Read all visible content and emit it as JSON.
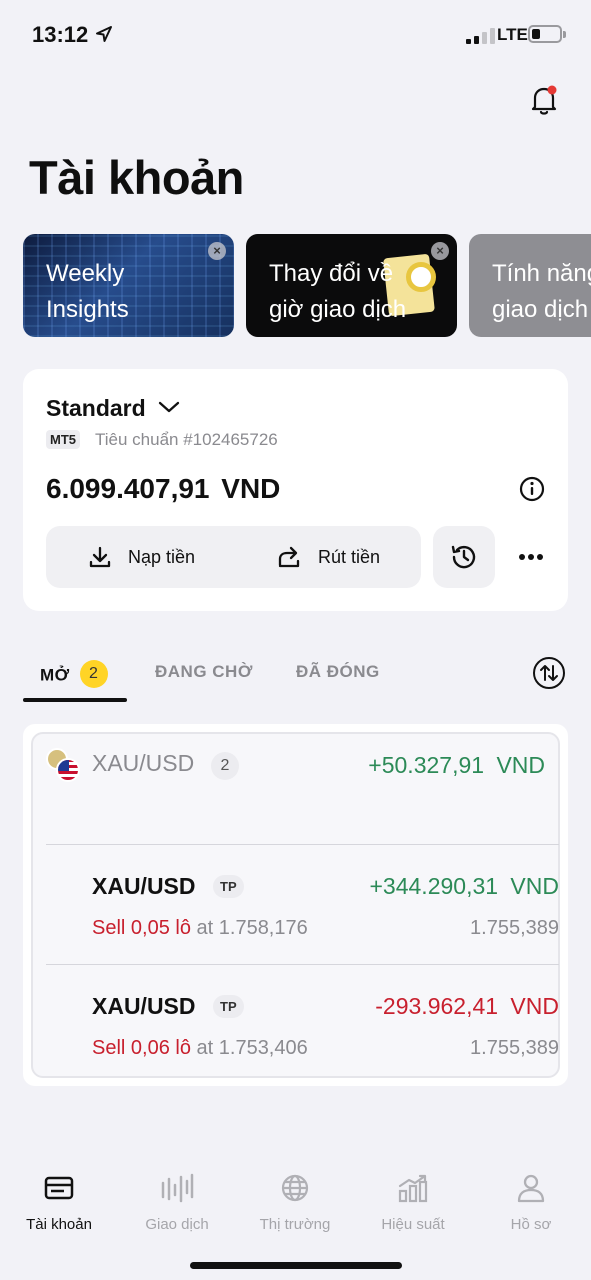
{
  "status_bar": {
    "time": "13:12",
    "network": "LTE"
  },
  "page_title": "Tài khoản",
  "promos": [
    {
      "text_line1": "Weekly",
      "text_line2": "Insights"
    },
    {
      "text_line1": "Thay đổi về",
      "text_line2": "giờ giao dịch"
    },
    {
      "text_line1": "Tính năng",
      "text_line2": "giao dịch"
    }
  ],
  "account": {
    "type": "Standard",
    "platform": "MT5",
    "subtitle": "Tiêu chuẩn #102465726",
    "balance": "6.099.407,91 VND",
    "deposit_label": "Nạp tiền",
    "withdraw_label": "Rút tiền"
  },
  "tabs": {
    "open_label": "MỞ",
    "open_count": "2",
    "pending_label": "ĐANG CHỜ",
    "closed_label": "ĐÃ ĐÓNG"
  },
  "positions": {
    "group": {
      "symbol": "XAU/USD",
      "count": "2",
      "pl": "+50.327,91 VND"
    },
    "items": [
      {
        "symbol": "XAU/USD",
        "badge": "TP",
        "pl": "+344.290,31 VND",
        "side_volume": "Sell 0,05 lô",
        "open_price": " at 1.758,176",
        "current_price": "1.755,389"
      },
      {
        "symbol": "XAU/USD",
        "badge": "TP",
        "pl": "-293.962,41 VND",
        "side_volume": "Sell 0,06 lô",
        "open_price": " at 1.753,406",
        "current_price": "1.755,389"
      }
    ]
  },
  "nav": {
    "account": "Tài khoản",
    "trade": "Giao dịch",
    "markets": "Thị trường",
    "performance": "Hiệu suất",
    "profile": "Hồ sơ"
  },
  "colors": {
    "profit": "#2c8a57",
    "loss": "#c8202e",
    "badge_yellow": "#ffd426",
    "notification_dot": "#e53935"
  }
}
